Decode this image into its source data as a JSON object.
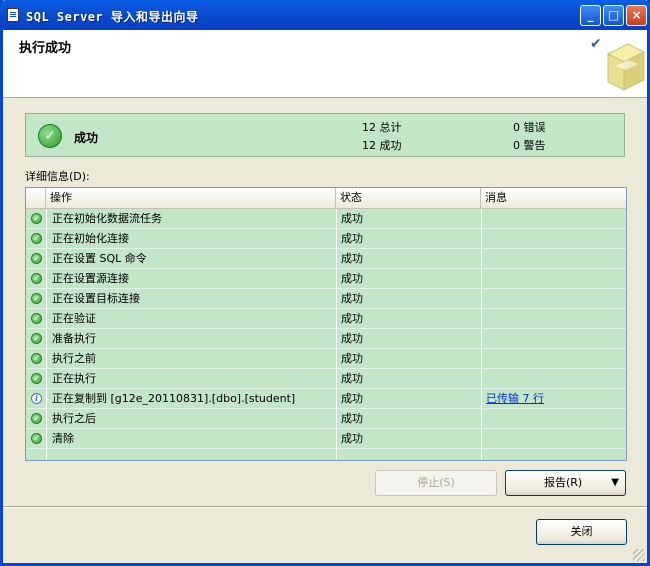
{
  "window": {
    "title": "SQL Server 导入和导出向导",
    "minimize_label": "_",
    "maximize_label": "□",
    "close_label": "×"
  },
  "header": {
    "title": "执行成功"
  },
  "summary": {
    "status": "成功",
    "total": "12 总计",
    "success": "12 成功",
    "errors": "0 错误",
    "warnings": "0 警告"
  },
  "details": {
    "label": "详细信息(D):",
    "columns": [
      "操作",
      "状态",
      "消息"
    ],
    "rows": [
      {
        "icon": "success-icon",
        "action": "正在初始化数据流任务",
        "status": "成功",
        "message": ""
      },
      {
        "icon": "success-icon",
        "action": "正在初始化连接",
        "status": "成功",
        "message": ""
      },
      {
        "icon": "success-icon",
        "action": "正在设置 SQL 命令",
        "status": "成功",
        "message": ""
      },
      {
        "icon": "success-icon",
        "action": "正在设置源连接",
        "status": "成功",
        "message": ""
      },
      {
        "icon": "success-icon",
        "action": "正在设置目标连接",
        "status": "成功",
        "message": ""
      },
      {
        "icon": "success-icon",
        "action": "正在验证",
        "status": "成功",
        "message": ""
      },
      {
        "icon": "success-icon",
        "action": "准备执行",
        "status": "成功",
        "message": ""
      },
      {
        "icon": "success-icon",
        "action": "执行之前",
        "status": "成功",
        "message": ""
      },
      {
        "icon": "success-icon",
        "action": "正在执行",
        "status": "成功",
        "message": ""
      },
      {
        "icon": "info-icon",
        "action": "正在复制到 [g12e_20110831].[dbo].[student]",
        "status": "成功",
        "message": "已传输 7 行"
      },
      {
        "icon": "success-icon",
        "action": "执行之后",
        "status": "成功",
        "message": ""
      },
      {
        "icon": "success-icon",
        "action": "清除",
        "status": "成功",
        "message": ""
      }
    ]
  },
  "buttons": {
    "stop": "停止(S)",
    "report": "报告(R)",
    "report_arrow": "▼",
    "close": "关闭"
  },
  "colors": {
    "success_bg": "#c3e5c8",
    "title_bar": "#0a5ee6"
  }
}
